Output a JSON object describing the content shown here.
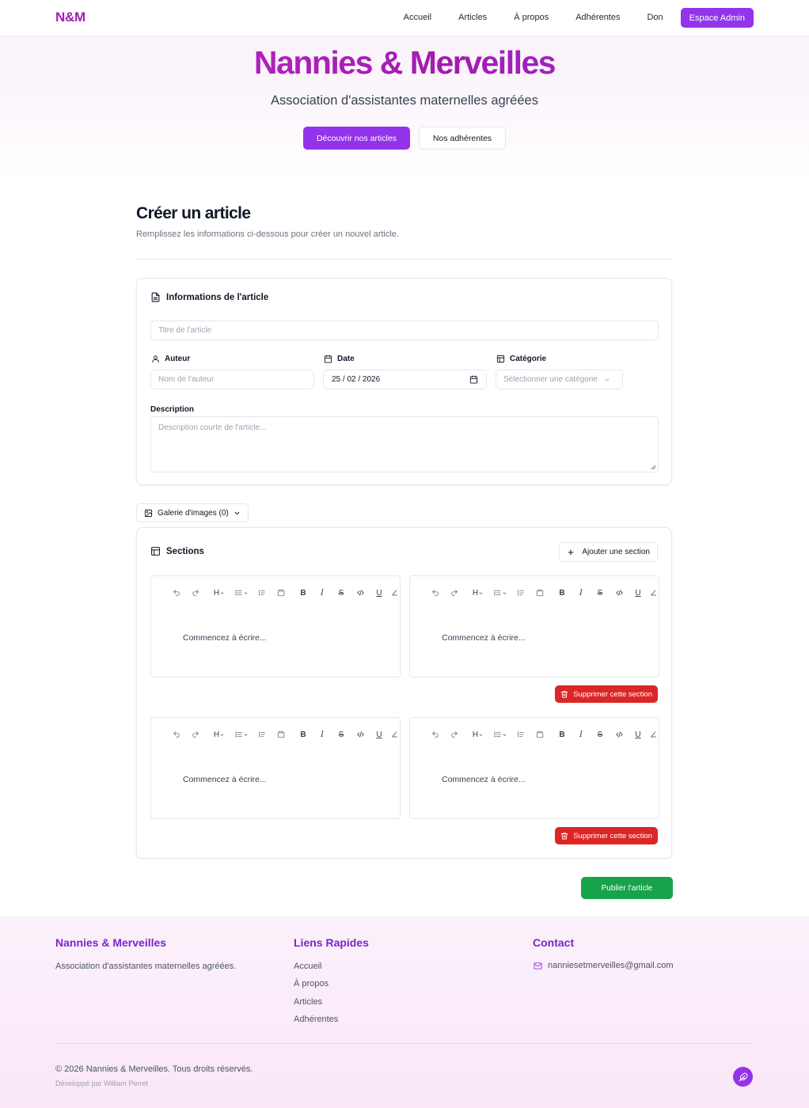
{
  "nav": {
    "logo": "N&M",
    "links": [
      "Accueil",
      "Articles",
      "À propos",
      "Adhérentes",
      "Don"
    ],
    "admin": "Espace Admin"
  },
  "hero": {
    "title": "Nannies & Merveilles",
    "subtitle": "Association d'assistantes maternelles agréées",
    "primary": "Découvrir nos articles",
    "secondary": "Nos adhérentes"
  },
  "page": {
    "title": "Créer un article",
    "subtitle": "Remplissez les informations ci-dessous pour créer un nouvel article."
  },
  "info": {
    "heading": "Informations de l'article",
    "title_placeholder": "Titre de l'article",
    "author_label": "Auteur",
    "author_placeholder": "Nom de l'auteur",
    "date_label": "Date",
    "date_value": "25 / 02 / 2026",
    "category_label": "Catégorie",
    "category_placeholder": "Sélectionner une catégorie",
    "description_label": "Description",
    "description_placeholder": "Description courte de l'article..."
  },
  "gallery": {
    "label": "Galerie d'images (0)"
  },
  "sections": {
    "heading": "Sections",
    "add": "Ajouter une section",
    "placeholder": "Commencez à écrire...",
    "delete": "Supprimer cette section",
    "toolbar": {
      "heading": "H",
      "bold": "B",
      "italic": "I",
      "strike": "S",
      "underline": "U"
    }
  },
  "publish": "Publier l'article",
  "footer": {
    "brand_title": "Nannies & Merveilles",
    "brand_text": "Association d'assistantes maternelles agréées.",
    "links_title": "Liens Rapides",
    "links": [
      "Accueil",
      "À propos",
      "Articles",
      "Adhérentes"
    ],
    "contact_title": "Contact",
    "email": "nanniesetmerveilles@gmail.com",
    "copyright": "© 2026 Nannies & Merveilles. Tous droits réservés.",
    "developer": "Développé par William Perret"
  },
  "colors": {
    "brand": "#9333ea",
    "accent": "#a21caf",
    "danger": "#dc2626",
    "success": "#16a34a"
  }
}
